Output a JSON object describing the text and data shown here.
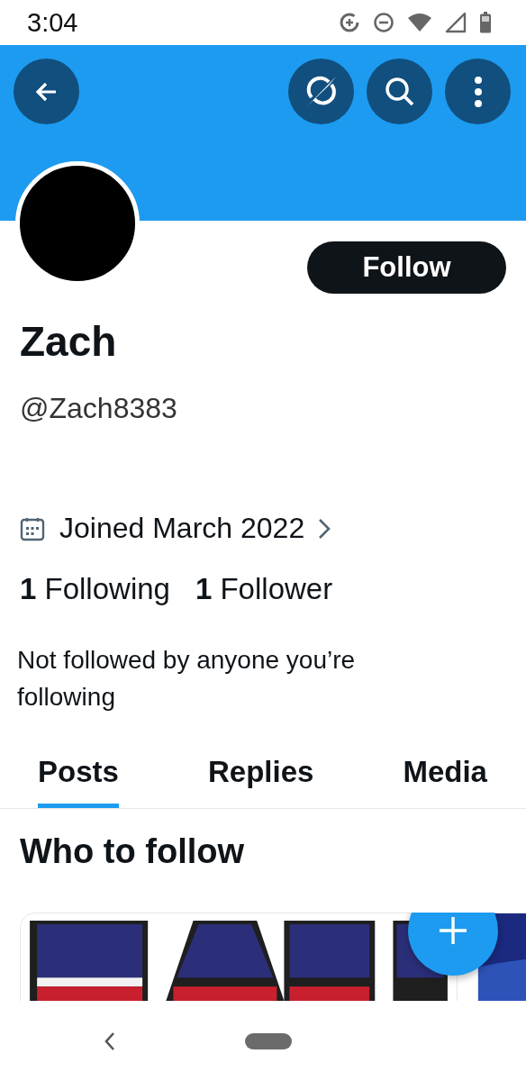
{
  "status_bar": {
    "time": "3:04"
  },
  "profile": {
    "name": "Zach",
    "handle": "@Zach8383",
    "follow_button": "Follow",
    "joined": "Joined March 2022",
    "following": {
      "count": "1",
      "label": "Following"
    },
    "followers": {
      "count": "1",
      "label": "Follower"
    },
    "note": "Not followed by anyone you’re following"
  },
  "tabs": [
    {
      "label": "Posts",
      "selected": true
    },
    {
      "label": "Replies",
      "selected": false
    },
    {
      "label": "Media",
      "selected": false
    }
  ],
  "who_to_follow": {
    "title": "Who to follow"
  }
}
